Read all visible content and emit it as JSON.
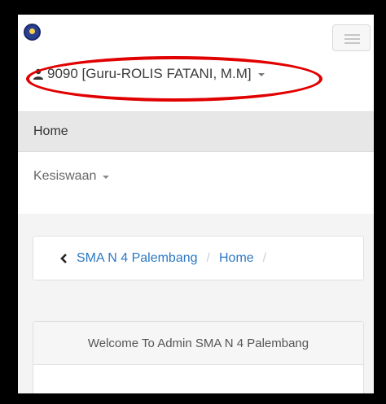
{
  "navbar": {
    "user_label": "9090 [Guru-ROLIS FATANI, M.M]"
  },
  "menu": {
    "items": [
      {
        "label": "Home"
      },
      {
        "label": "Kesiswaan"
      }
    ]
  },
  "breadcrumb": {
    "items": [
      "SMA N 4 Palembang",
      "Home"
    ],
    "separator": "/"
  },
  "panel": {
    "heading": "Welcome To Admin SMA N 4 Palembang"
  },
  "colors": {
    "link": "#2c78c3",
    "highlight": "#e10000",
    "active_menu_bg": "#e7e7e7"
  }
}
